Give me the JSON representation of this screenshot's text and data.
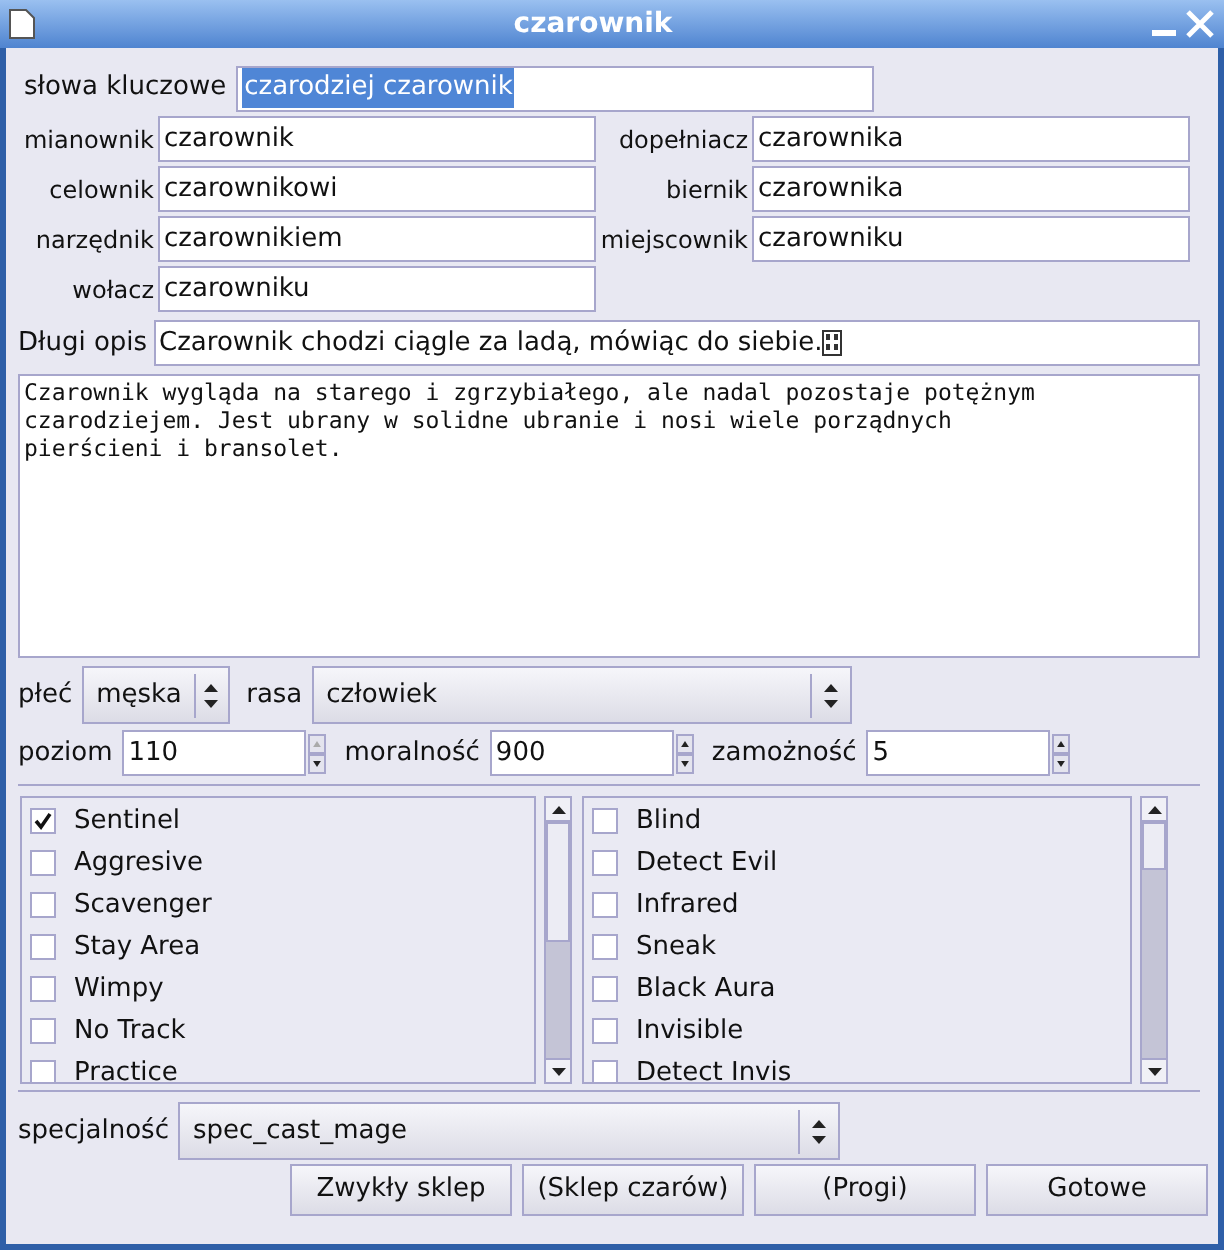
{
  "window": {
    "title": "czarownik"
  },
  "keywords": {
    "label": "słowa kluczowe",
    "value": "czarodziej czarownik",
    "selected": true
  },
  "cases": [
    {
      "label": "mianownik",
      "value": "czarownik"
    },
    {
      "label": "dopełniacz",
      "value": "czarownika"
    },
    {
      "label": "celownik",
      "value": "czarownikowi"
    },
    {
      "label": "biernik",
      "value": "czarownika"
    },
    {
      "label": "narzędnik",
      "value": "czarownikiem"
    },
    {
      "label": "miejscownik",
      "value": "czarowniku"
    },
    {
      "label": "wołacz",
      "value": "czarowniku"
    }
  ],
  "long_description": {
    "label": "Długi opis",
    "value": "Czarownik chodzi ciągle za ladą, mówiąc do siebie."
  },
  "description": "Czarownik wygląda na starego i zgrzybiałego, ale nadal pozostaje potężnym\nczarodziejem. Jest ubrany w solidne ubranie i nosi wiele porządnych\npierścieni i bransolet.",
  "sex": {
    "label": "płeć",
    "value": "męska"
  },
  "race": {
    "label": "rasa",
    "value": "człowiek"
  },
  "spins": [
    {
      "label": "poziom",
      "value": "110",
      "up_disabled": true
    },
    {
      "label": "moralność",
      "value": "900",
      "up_disabled": false
    },
    {
      "label": "zamożność",
      "value": "5",
      "up_disabled": false
    }
  ],
  "flags_left": [
    {
      "label": "Sentinel",
      "checked": true
    },
    {
      "label": "Aggresive",
      "checked": false
    },
    {
      "label": "Scavenger",
      "checked": false
    },
    {
      "label": "Stay Area",
      "checked": false
    },
    {
      "label": "Wimpy",
      "checked": false
    },
    {
      "label": "No Track",
      "checked": false
    },
    {
      "label": "Practice",
      "checked": false
    }
  ],
  "flags_right": [
    {
      "label": "Blind",
      "checked": false
    },
    {
      "label": "Detect Evil",
      "checked": false
    },
    {
      "label": "Infrared",
      "checked": false
    },
    {
      "label": "Sneak",
      "checked": false
    },
    {
      "label": "Black Aura",
      "checked": false
    },
    {
      "label": "Invisible",
      "checked": false
    },
    {
      "label": "Detect Invis",
      "checked": false
    }
  ],
  "specialty": {
    "label": "specjalność",
    "value": "spec_cast_mage"
  },
  "buttons": [
    "Zwykły sklep",
    "(Sklep czarów)",
    "(Progi)",
    "Gotowe"
  ]
}
